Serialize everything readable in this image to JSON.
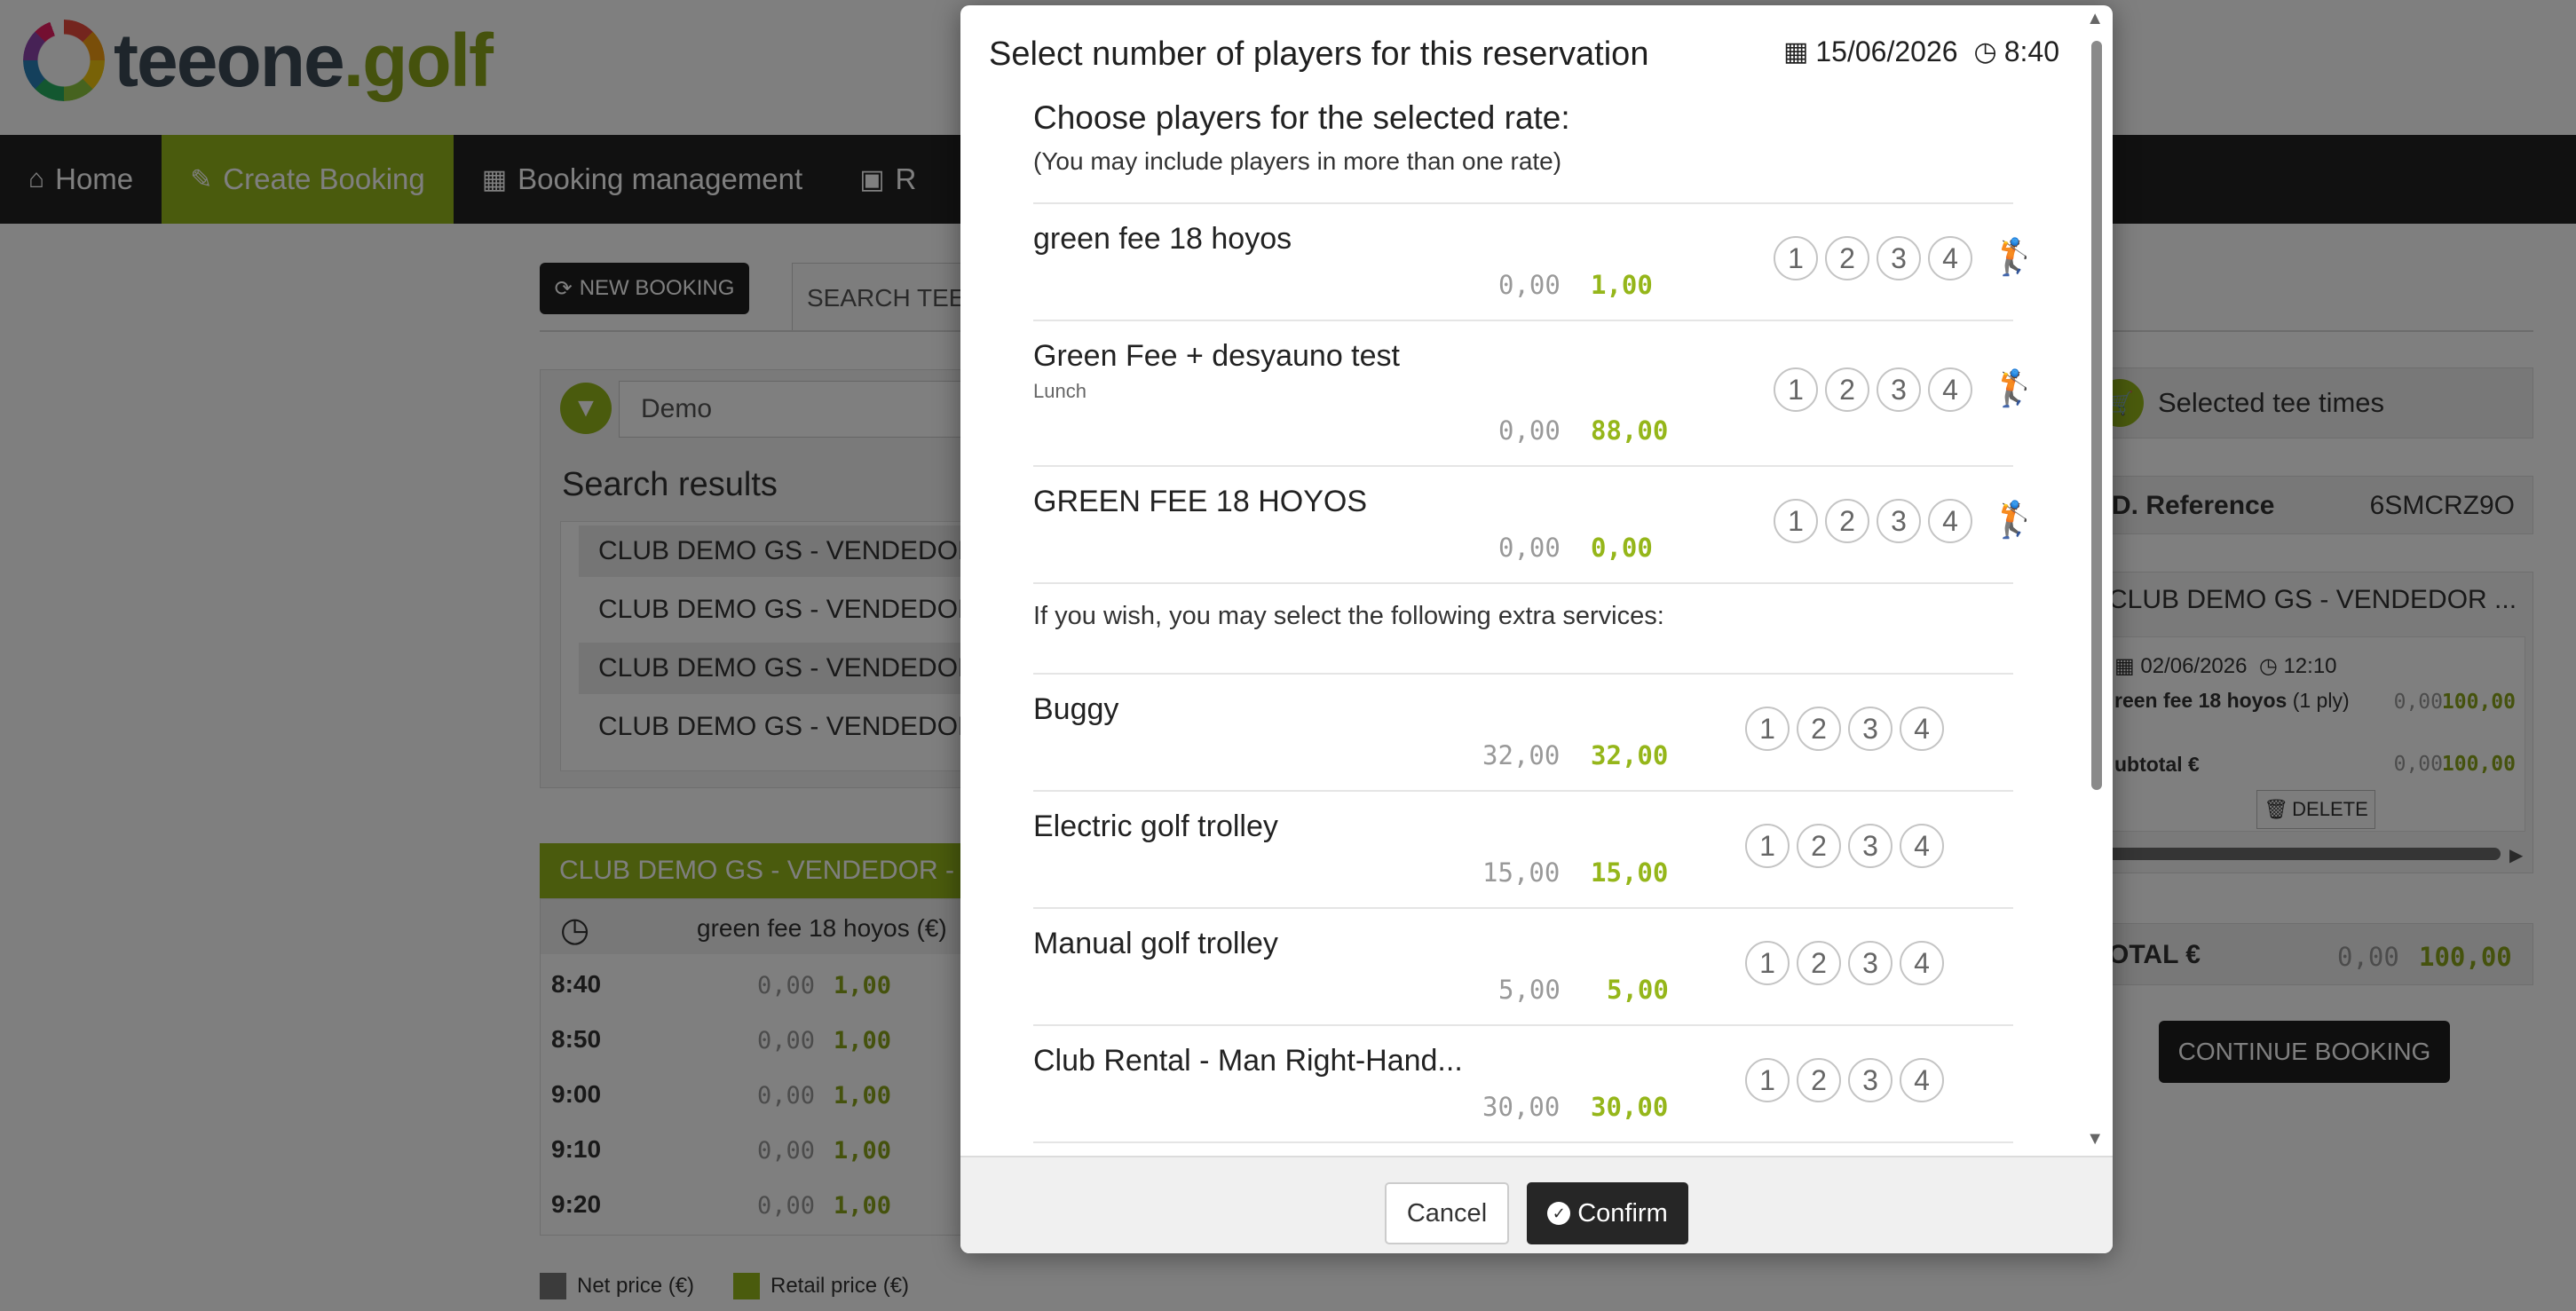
{
  "brand": {
    "logo_part1": "tee",
    "logo_part2": "one",
    "logo_dot": ".",
    "logo_part3": "golf"
  },
  "nav": {
    "items": [
      {
        "label": "Home",
        "icon": "home-icon"
      },
      {
        "label": "Create Booking",
        "icon": "edit-icon"
      },
      {
        "label": "Booking management",
        "icon": "table-icon"
      },
      {
        "label": "R",
        "icon": "money-icon"
      }
    ]
  },
  "page": {
    "new_booking_label": "NEW BOOKING",
    "search_tab_label": "SEARCH TEE",
    "filter_value": "Demo",
    "results_title": "Search results",
    "results": [
      "CLUB DEMO GS - VENDEDOR",
      "CLUB DEMO GS - VENDEDOR",
      "CLUB DEMO GS - VENDEDOR",
      "CLUB DEMO GS - VENDEDOR"
    ],
    "club_bar": "CLUB DEMO GS - VENDEDOR - ",
    "tee_table": {
      "rate_header": "green fee 18 hoyos (€)",
      "rows": [
        {
          "time": "8:40",
          "net": "0,00",
          "retail": "1,00"
        },
        {
          "time": "8:50",
          "net": "0,00",
          "retail": "1,00"
        },
        {
          "time": "9:00",
          "net": "0,00",
          "retail": "1,00"
        },
        {
          "time": "9:10",
          "net": "0,00",
          "retail": "1,00"
        },
        {
          "time": "9:20",
          "net": "0,00",
          "retail": "1,00"
        }
      ]
    },
    "legend": {
      "net": "Net price (€)",
      "retail": "Retail price (€)"
    },
    "legend_colors": {
      "net": "#777777",
      "retail": "#95b61a"
    }
  },
  "cart": {
    "header": "Selected tee times",
    "ref_label": "D. Reference",
    "ref_value": "6SMCRZ9O",
    "club": "CLUB DEMO GS - VENDEDOR ...",
    "date": "02/06/2026",
    "time": "12:10",
    "line_name": "reen fee 18 hoyos",
    "line_players": "(1 ply)",
    "line_net": "0,00",
    "line_retail": "100,00",
    "subtotal_label": "ubtotal €",
    "subtotal_net": "0,00",
    "subtotal_retail": "100,00",
    "delete_label": "DELETE",
    "total_label": "OTAL  €",
    "total_net": "0,00",
    "total_retail": "100,00",
    "continue_label": "CONTINUE BOOKING"
  },
  "modal": {
    "title": "Select number of players for this reservation",
    "date": "15/06/2026",
    "time": "8:40",
    "heading": "Choose players for the selected rate:",
    "subheading": "(You may include players in more than one rate)",
    "player_options": [
      "1",
      "2",
      "3",
      "4"
    ],
    "rates": [
      {
        "name": "green fee 18 hoyos",
        "sub": "",
        "net": "0,00",
        "retail": "1,00"
      },
      {
        "name": "Green Fee + desyauno test",
        "sub": "Lunch",
        "net": "0,00",
        "retail": "88,00"
      },
      {
        "name": "GREEN FEE 18 HOYOS",
        "sub": "",
        "net": "0,00",
        "retail": "0,00"
      }
    ],
    "extras_label": "If you wish, you may select the following extra services:",
    "extras": [
      {
        "name": "Buggy",
        "net": "32,00",
        "retail": "32,00"
      },
      {
        "name": "Electric golf trolley",
        "net": "15,00",
        "retail": "15,00"
      },
      {
        "name": "Manual golf trolley",
        "net": "5,00",
        "retail": "5,00"
      },
      {
        "name": "Club Rental - Man Right-Hand...",
        "net": "30,00",
        "retail": "30,00"
      }
    ],
    "cancel_label": "Cancel",
    "confirm_label": "Confirm"
  },
  "colors": {
    "accent": "#95b61a",
    "dark": "#232323"
  }
}
